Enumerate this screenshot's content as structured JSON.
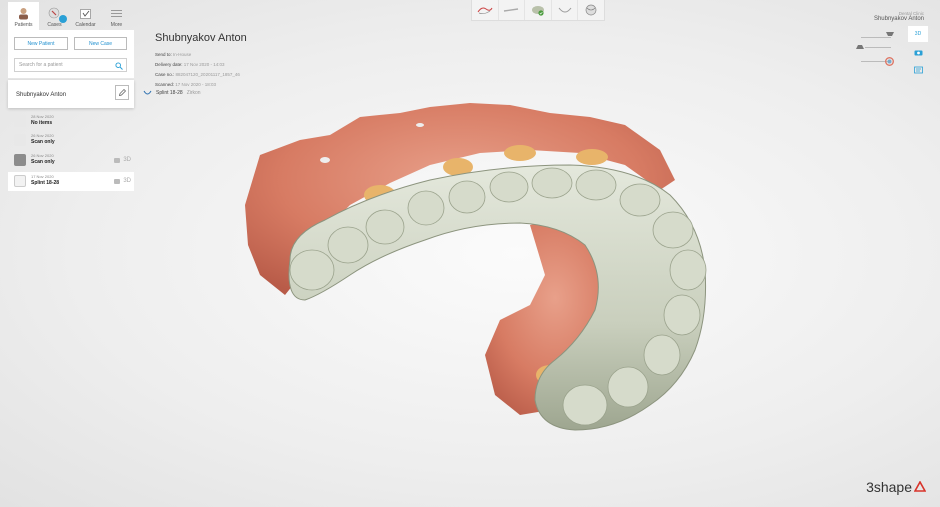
{
  "nav": {
    "tabs": [
      {
        "label": "Patients",
        "icon": "patients-icon"
      },
      {
        "label": "Cases",
        "icon": "cases-icon",
        "badge": ""
      },
      {
        "label": "Calendar",
        "icon": "calendar-icon"
      },
      {
        "label": "More",
        "icon": "menu-icon"
      }
    ]
  },
  "patients": {
    "new_patient_label": "New Patient",
    "new_case_label": "New Case",
    "search_placeholder": "Search for a patient",
    "selected_patient": "Shubnyakov Anton"
  },
  "cases": [
    {
      "date": "28 Nov 2020",
      "title": "No items",
      "tags": ""
    },
    {
      "date": "26 Nov 2020",
      "title": "Scan only",
      "tags": ""
    },
    {
      "date": "26 Nov 2020",
      "title": "Scan only",
      "tags": "3D"
    },
    {
      "date": "17 Nov 2020",
      "title": "Splint 18-28",
      "tags": "3D"
    }
  ],
  "header": {
    "patient": "Shubnyakov Anton",
    "send_to_label": "Send to:",
    "send_to_value": "In-House",
    "delivery_label": "Delivery date:",
    "delivery_value": "17 Nov 2020 - 14:03",
    "case_no_label": "Case no.:",
    "case_no_value": "882047120_20201117_1857_46",
    "scanned_label": "Scanned:",
    "scanned_value": "17 Nov 2020 - 18:03",
    "splint_label": "Splint 18-28",
    "splint_value": "Zirkon"
  },
  "clinic": {
    "label": "Dental Clinic",
    "patient": "Shubnyakov Anton"
  },
  "side_buttons": {
    "view_3d": "3D"
  },
  "brand": {
    "name": "3shape"
  },
  "colors": {
    "accent": "#2aa0d6",
    "gum": "#d9806a",
    "splint": "#cdd3c3"
  }
}
